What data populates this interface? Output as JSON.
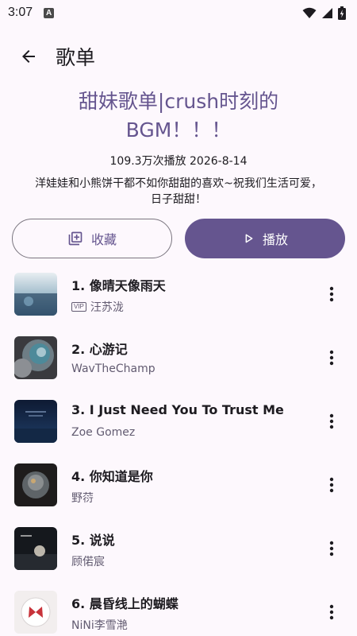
{
  "status_bar": {
    "time": "3:07",
    "notif_icon_letter": "A"
  },
  "header": {
    "title": "歌单",
    "back_icon": "arrow-back-icon"
  },
  "playlist": {
    "title_line1": "甜妹歌单|crush时刻的",
    "title_line2": "BGM！！！",
    "meta": "109.3万次播放 2026-8-14",
    "description": "洋娃娃和小熊饼干都不如你甜甜的喜欢~祝我们生活可爱，日子甜甜！"
  },
  "actions": {
    "collect_label": "收藏",
    "play_label": "播放"
  },
  "colors": {
    "accent": "#65558f",
    "background": "#fdf8fd",
    "text_secondary": "#625b71"
  },
  "songs": [
    {
      "title": "1. 像晴天像雨天",
      "artist": "汪苏泷",
      "vip": "VIP"
    },
    {
      "title": "2. 心游记",
      "artist": "WavTheChamp"
    },
    {
      "title": "3. I Just Need You To Trust Me",
      "artist": "Zoe Gomez"
    },
    {
      "title": "4. 你知道是你",
      "artist": "野葕"
    },
    {
      "title": "5. 说说",
      "artist": "顾偌宸"
    },
    {
      "title": "6. 晨昏线上的蝴蝶",
      "artist": "NiNi李雪滟"
    }
  ]
}
